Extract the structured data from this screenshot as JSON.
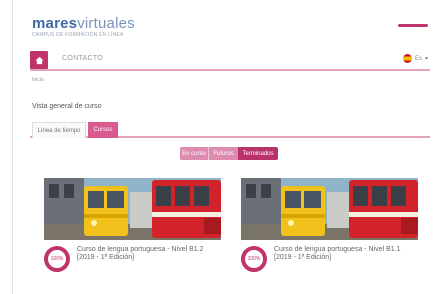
{
  "header": {
    "logo_bold": "mares",
    "logo_light": "virtuales",
    "logo_sub": "CAMPUS DE FORMACIÓN EN LÍNEA"
  },
  "nav": {
    "home_icon": "home-icon",
    "link": "CONTACTO",
    "language": "Es"
  },
  "breadcrumb": "Inicio",
  "overview": {
    "title": "Vista general de curso",
    "tabs": [
      {
        "label": "Línea de tiempo",
        "active": false
      },
      {
        "label": "Cursos",
        "active": true
      }
    ]
  },
  "filters": [
    {
      "label": "En curso",
      "active": false
    },
    {
      "label": "Futuros",
      "active": false
    },
    {
      "label": "Terminados",
      "active": true
    }
  ],
  "courses": [
    {
      "title": "Curso de lengua portuguesa - Nivel B1.2 [2019 - 1ª Edición]",
      "progress_label": "100%",
      "progress": 1.0
    },
    {
      "title": "Curso de lengua portuguesa - Nivel B1.1 [2019 - 1ª Edición]",
      "progress_label": "100%",
      "progress": 1.0
    }
  ],
  "colors": {
    "accent": "#c0346b",
    "accent_light": "#e3a2bd",
    "logo_blue": "#3f6aa6"
  }
}
